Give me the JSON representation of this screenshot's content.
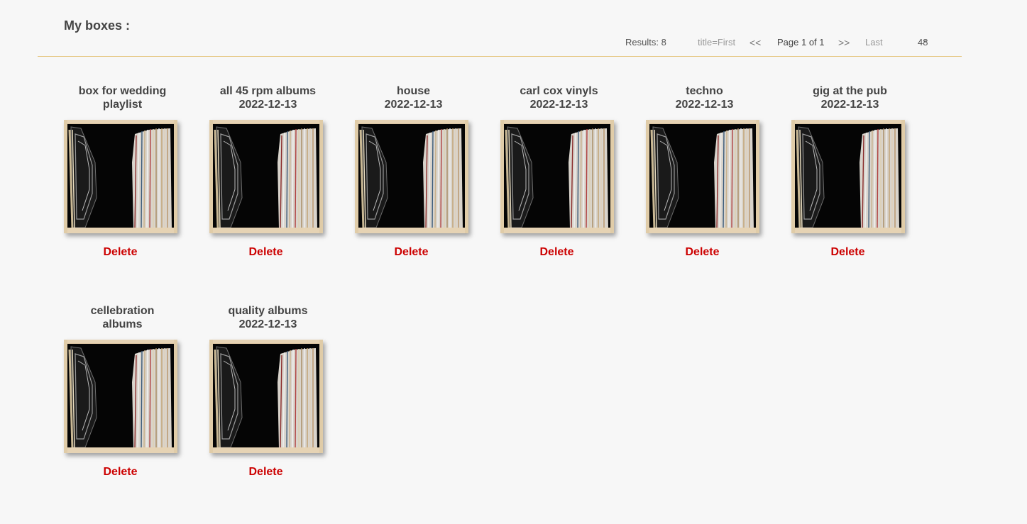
{
  "page": {
    "title": "My boxes :"
  },
  "toolbar": {
    "results": "Results: 8",
    "first": "title=First",
    "prev": "<<",
    "page_info": "Page 1 of 1",
    "next": ">>",
    "last": "Last",
    "per_page": "48"
  },
  "boxes": [
    {
      "title_line1": "box for wedding",
      "title_line2": "playlist",
      "delete_label": "Delete"
    },
    {
      "title_line1": "all 45 rpm albums",
      "title_line2": "2022-12-13",
      "delete_label": "Delete"
    },
    {
      "title_line1": "house",
      "title_line2": "2022-12-13",
      "delete_label": "Delete"
    },
    {
      "title_line1": "carl cox vinyls",
      "title_line2": "2022-12-13",
      "delete_label": "Delete"
    },
    {
      "title_line1": "techno",
      "title_line2": "2022-12-13",
      "delete_label": "Delete"
    },
    {
      "title_line1": "gig at the pub",
      "title_line2": "2022-12-13",
      "delete_label": "Delete"
    },
    {
      "title_line1": "cellebration",
      "title_line2": "albums",
      "delete_label": "Delete"
    },
    {
      "title_line1": "quality albums",
      "title_line2": "2022-12-13",
      "delete_label": "Delete"
    }
  ],
  "colors": {
    "accent_line": "#e5c47a",
    "delete": "#cc0000"
  },
  "icons": {
    "per_page_chevron": "chevron-down-icon",
    "box_image": "record-crate-image"
  }
}
